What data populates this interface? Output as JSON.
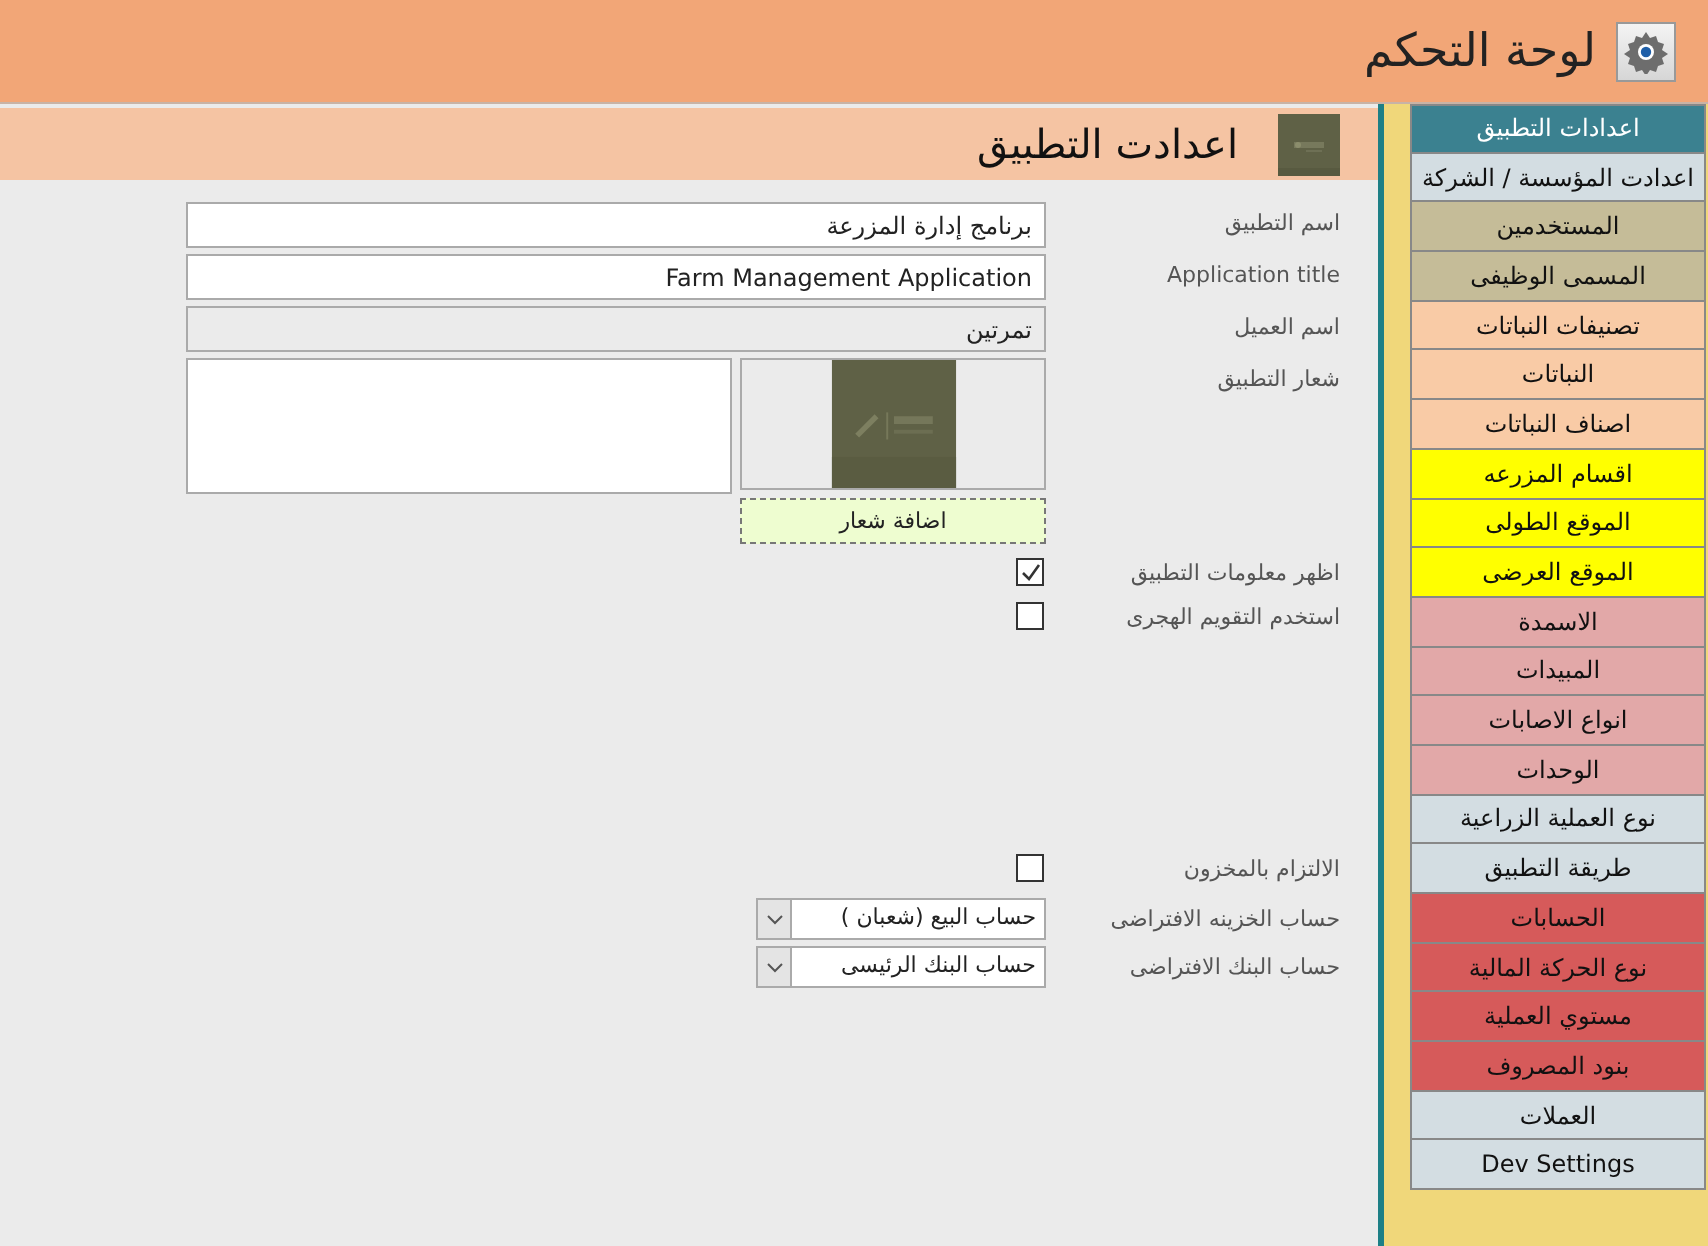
{
  "window": {
    "title": "لوحة التحكم"
  },
  "section": {
    "title": "اعدادت التطبيق"
  },
  "form": [
    {
      "kind": "text",
      "label": "اسم التطبيق",
      "value": "برنامج إدارة المزرعة",
      "disabled": false
    },
    {
      "kind": "text",
      "label": "Application title",
      "value": "Farm Management Application",
      "disabled": false
    },
    {
      "kind": "text",
      "label": "اسم العميل",
      "value": "تمرتين",
      "disabled": true
    },
    {
      "kind": "logo",
      "label": "شعار التطبيق",
      "button": "اضافة شعار"
    },
    {
      "kind": "checkbox",
      "label": "اظهر معلومات التطبيق",
      "checked": true
    },
    {
      "kind": "checkbox",
      "label": "استخدم التقويم الهجرى",
      "checked": false
    }
  ],
  "accounts": [
    {
      "kind": "checkbox",
      "label": "الالتزام بالمخزون",
      "checked": false
    },
    {
      "kind": "dropdown",
      "label": "حساب الخزينه الافتراضى",
      "value": "حساب البيع (شعبان )"
    },
    {
      "kind": "dropdown",
      "label": "حساب البنك الافتراضى",
      "value": "حساب البنك الرئيسى"
    }
  ],
  "sidebar": {
    "items": [
      {
        "label": "اعدادات التطبيق",
        "selected": true,
        "color": "#3b8190"
      },
      {
        "label": "اعدادت المؤسسة / الشركة",
        "selected": false,
        "color": "#d3dde2"
      },
      {
        "label": "المستخدمين",
        "selected": false,
        "color": "#c5bc98"
      },
      {
        "label": "المسمى الوظيفى",
        "selected": false,
        "color": "#c5bc98"
      },
      {
        "label": "تصنيفات النباتات",
        "selected": false,
        "color": "#f9cba6"
      },
      {
        "label": "النباتات",
        "selected": false,
        "color": "#f9cba6"
      },
      {
        "label": "اصناف النباتات",
        "selected": false,
        "color": "#f9cba6"
      },
      {
        "label": "اقسام المزرعه",
        "selected": false,
        "color": "#ffff00"
      },
      {
        "label": "الموقع الطولى",
        "selected": false,
        "color": "#ffff00"
      },
      {
        "label": "الموقع العرضى",
        "selected": false,
        "color": "#ffff00"
      },
      {
        "label": "الاسمدة",
        "selected": false,
        "color": "#e2a8a8"
      },
      {
        "label": "المبيدات",
        "selected": false,
        "color": "#e2a8a8"
      },
      {
        "label": "انواع الاصابات",
        "selected": false,
        "color": "#e2a8a8"
      },
      {
        "label": "الوحدات",
        "selected": false,
        "color": "#e2a8a8"
      },
      {
        "label": "نوع العملية الزراعية",
        "selected": false,
        "color": "#d3dde2"
      },
      {
        "label": "طريقة التطبيق",
        "selected": false,
        "color": "#d3dde2"
      },
      {
        "label": "الحسابات",
        "selected": false,
        "color": "#d65a5a"
      },
      {
        "label": "نوع الحركة المالية",
        "selected": false,
        "color": "#d65a5a"
      },
      {
        "label": "مستوي العملية",
        "selected": false,
        "color": "#d65a5a"
      },
      {
        "label": "بنود المصروف",
        "selected": false,
        "color": "#d65a5a"
      },
      {
        "label": "العملات",
        "selected": false,
        "color": "#d3dde2"
      },
      {
        "label": "Dev Settings",
        "selected": false,
        "color": "#d3dde2"
      }
    ]
  }
}
